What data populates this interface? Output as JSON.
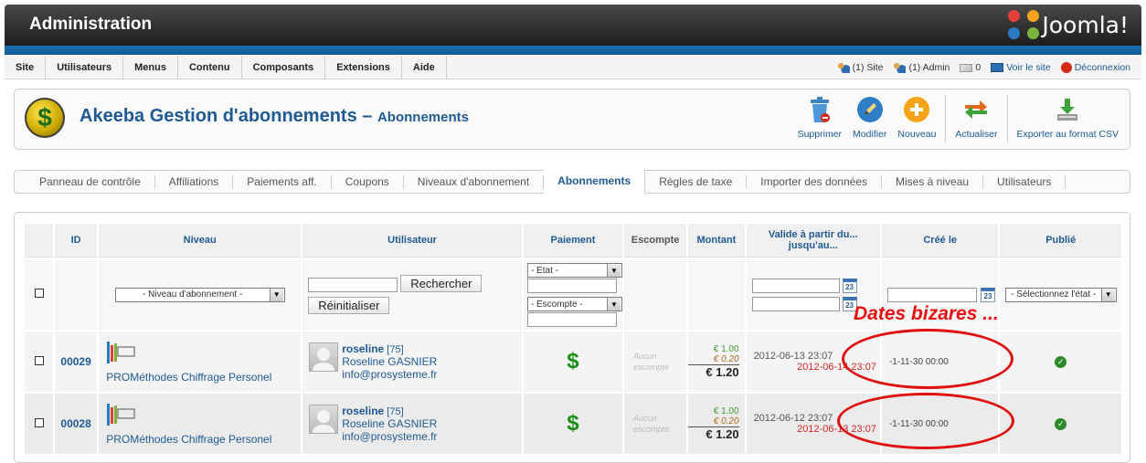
{
  "header": {
    "title": "Administration",
    "brand": "Joomla!"
  },
  "menu": [
    "Site",
    "Utilisateurs",
    "Menus",
    "Contenu",
    "Composants",
    "Extensions",
    "Aide"
  ],
  "status": {
    "site": "(1) Site",
    "admin": "(1) Admin",
    "messages": "0",
    "view_site": "Voir le site",
    "logout": "Déconnexion"
  },
  "page": {
    "component": "Akeeba Gestion d'abonnements",
    "dash": "–",
    "view": "Abonnements"
  },
  "toolbar": [
    {
      "label": "Supprimer",
      "icon": "trash-icon"
    },
    {
      "label": "Modifier",
      "icon": "pencil-icon"
    },
    {
      "label": "Nouveau",
      "icon": "plus-icon"
    },
    {
      "label": "Actualiser",
      "icon": "refresh-icon"
    },
    {
      "label": "Exporter au format CSV",
      "icon": "download-icon"
    }
  ],
  "tabs": [
    "Panneau de contrôle",
    "Affiliations",
    "Paiements aff.",
    "Coupons",
    "Niveaux d'abonnement",
    "Abonnements",
    "Règles de taxe",
    "Importer des données",
    "Mises à niveau",
    "Utilisateurs"
  ],
  "active_tab": "Abonnements",
  "table": {
    "headers": {
      "id": "ID",
      "level": "Niveau",
      "user": "Utilisateur",
      "payment": "Paiement",
      "discount": "Escompte",
      "amount": "Montant",
      "valid": "Valide à partir du... jusqu'au...",
      "created": "Créé le",
      "published": "Publié"
    },
    "filters": {
      "level_select": "- Niveau d'abonnement -",
      "search_button": "Rechercher",
      "reset_button": "Réinitialiser",
      "state_select": "- État -",
      "discount_select": "- Escompte -",
      "published_select": "- Sélectionnez l'état -",
      "calendar": "23"
    },
    "rows": [
      {
        "id": "00029",
        "level": "PROMéthodes Chiffrage Personel",
        "username": "roseline",
        "userid": "[75]",
        "fullname": "Roseline GASNIER",
        "email": "info@prosysteme.fr",
        "payment": "$",
        "discount": "Aucun escompte",
        "net": "€ 1.00",
        "tax": "€ 0.20",
        "gross": "€ 1.20",
        "start": "2012-06-13 23:07",
        "end": "2012-06-14 23:07",
        "created": "-1-11-30 00:00"
      },
      {
        "id": "00028",
        "level": "PROMéthodes Chiffrage Personel",
        "username": "roseline",
        "userid": "[75]",
        "fullname": "Roseline GASNIER",
        "email": "info@prosysteme.fr",
        "payment": "$",
        "discount": "Aucun escompte",
        "net": "€ 1.00",
        "tax": "€ 0.20",
        "gross": "€ 1.20",
        "start": "2012-06-12 23:07",
        "end": "2012-06-13 23:07",
        "created": "-1-11-30 00:00"
      }
    ]
  },
  "annotation": "Dates bizares ...",
  "colors": {
    "accent_blue": "#1f5a92",
    "annotation_red": "#e01010",
    "amount_green": "#3d9a35"
  }
}
